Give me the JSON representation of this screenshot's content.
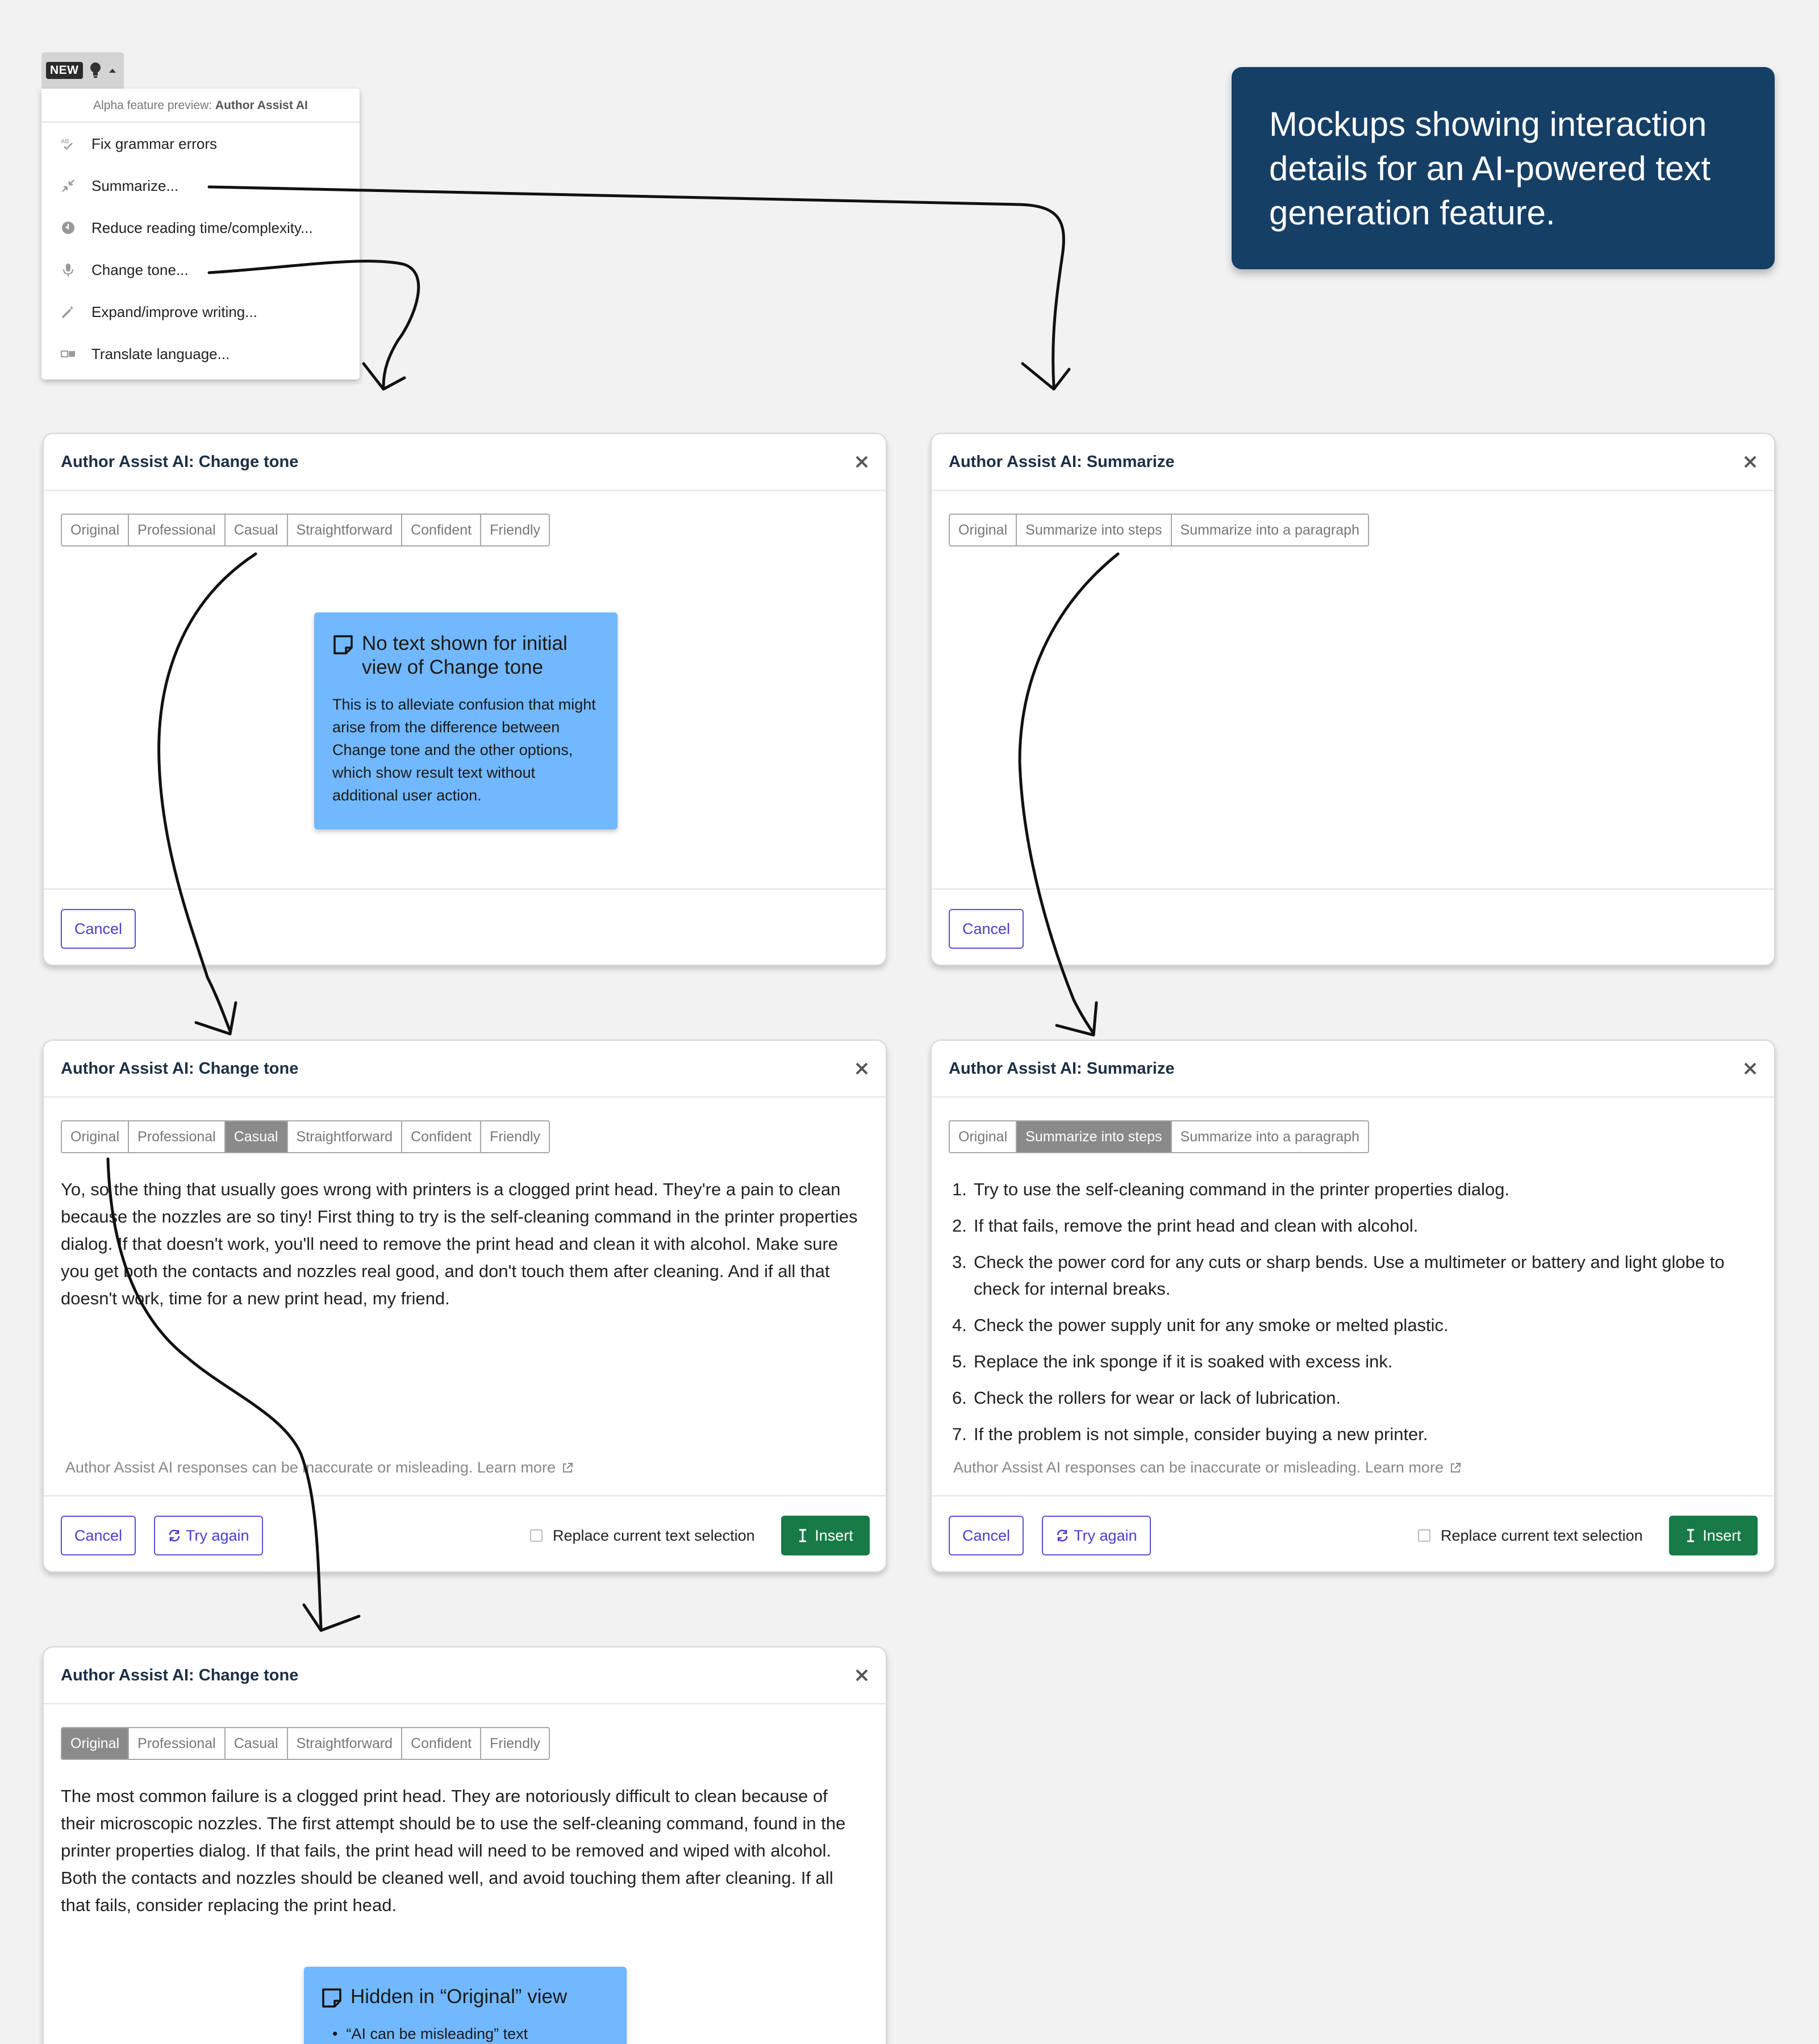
{
  "toolbar": {
    "badge": "NEW"
  },
  "menu": {
    "header_prefix": "Alpha feature preview: ",
    "header_strong": "Author Assist AI",
    "items": [
      {
        "label": "Fix grammar errors",
        "icon": "spellcheck-icon"
      },
      {
        "label": "Summarize...",
        "icon": "compress-icon"
      },
      {
        "label": "Reduce reading time/complexity...",
        "icon": "clock-icon"
      },
      {
        "label": "Change tone...",
        "icon": "microphone-icon"
      },
      {
        "label": "Expand/improve writing...",
        "icon": "magic-wand-icon"
      },
      {
        "label": "Translate language...",
        "icon": "translate-icon"
      }
    ]
  },
  "title_note": "Mockups showing interaction details for an AI-powered text generation feature.",
  "tone_tabs": [
    "Original",
    "Professional",
    "Casual",
    "Straightforward",
    "Confident",
    "Friendly"
  ],
  "summary_tabs": [
    "Original",
    "Summarize into steps",
    "Summarize into a paragraph"
  ],
  "dialogs": {
    "tone_title": "Author Assist AI: Change tone",
    "summary_title": "Author Assist AI: Summarize",
    "cancel": "Cancel",
    "try_again": "Try again",
    "replace": "Replace current text selection",
    "insert": "Insert",
    "disclaimer": "Author Assist AI responses can be inaccurate or misleading. Learn more"
  },
  "note_initial": {
    "title": "No text shown for initial view of Change tone",
    "body": "This is to alleviate confusion that might arise from the difference between Change tone and the other options, which show result text without additional user action."
  },
  "casual_text": "Yo, so the thing that usually goes wrong with printers is a clogged print head. They're a pain to clean because the nozzles are so tiny! First thing to try is the self-cleaning command in the printer properties dialog. If that doesn't work, you'll need to remove the print head and clean it with alcohol. Make sure you get both the contacts and nozzles real good, and don't touch them after cleaning. And if all that doesn't work, time for a new print head, my friend.",
  "original_text": "The most common failure is a clogged print head. They are notoriously difficult to clean because of their microscopic nozzles. The first attempt should be to use the self-cleaning command, found in the printer properties dialog. If that fails, the print head will need to be removed and wiped with alcohol. Both the contacts and nozzles should be cleaned well, and avoid touching them after cleaning. If all that fails, consider replacing the print head.",
  "steps": [
    {
      "n": "1.",
      "text": "Try to use the self-cleaning command in the printer properties dialog."
    },
    {
      "n": "2.",
      "text": "If that fails, remove the print head and clean with alcohol."
    },
    {
      "n": "3.",
      "text": "Check the power cord for any cuts or sharp bends. Use a multimeter or battery and light globe to check for internal breaks."
    },
    {
      "n": "4.",
      "text": "Check the power supply unit for any smoke or melted plastic."
    },
    {
      "n": "5.",
      "text": "Replace the ink sponge if it is soaked with excess ink."
    },
    {
      "n": "6.",
      "text": "Check the rollers for wear or lack of lubrication."
    },
    {
      "n": "7.",
      "text": "If the problem is not simple, consider buying a new printer."
    }
  ],
  "note_hidden": {
    "title": "Hidden in “Original” view",
    "bullet": "“AI can be misleading” text"
  },
  "colors": {
    "background": "#f2f2f2",
    "title_note": "#163f66",
    "sticky": "#72b8ff",
    "accent": "#5a4fd6",
    "insert": "#187a47",
    "active_tab": "#8a8a8a"
  }
}
